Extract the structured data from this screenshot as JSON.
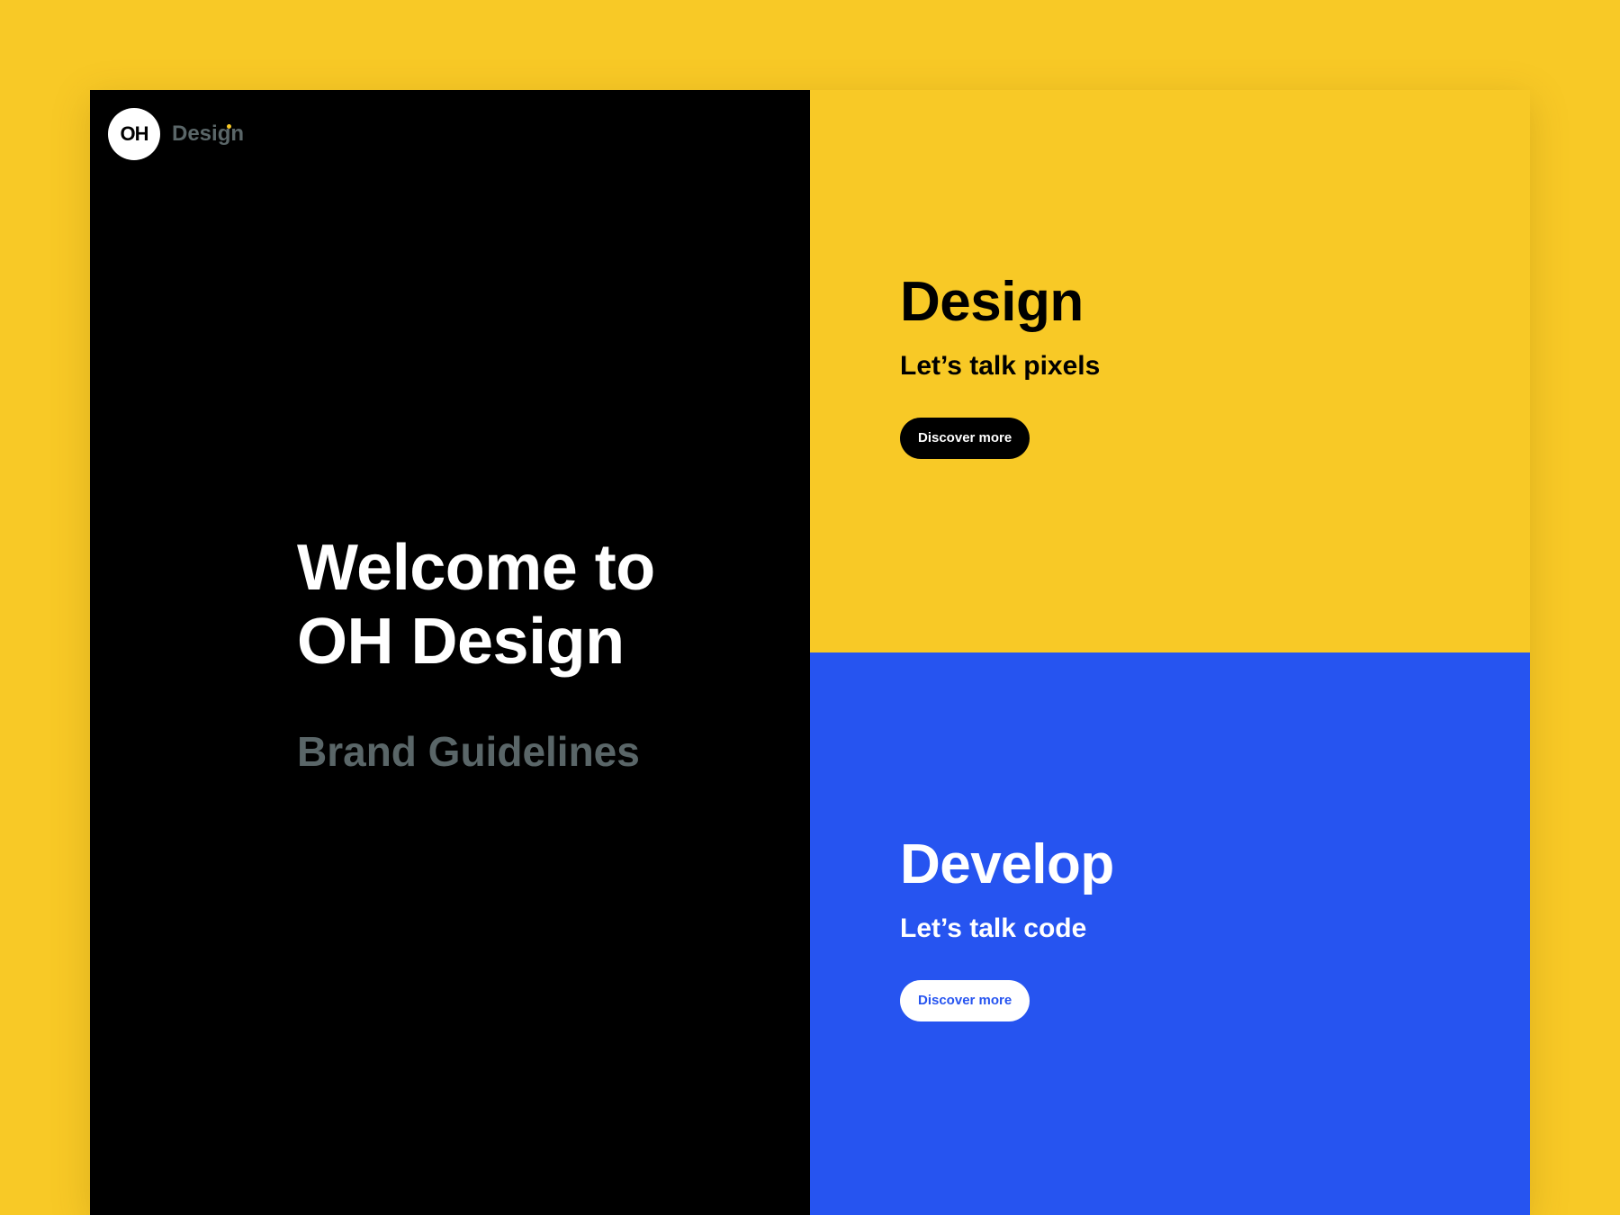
{
  "colors": {
    "background": "#F8C926",
    "left_panel": "#000000",
    "design_card": "#F8C926",
    "develop_card": "#2654F0",
    "muted_text": "#5A6668"
  },
  "logo": {
    "badge": "OH",
    "text": "Design"
  },
  "hero": {
    "title_line1": "Welcome to",
    "title_line2": "OH Design",
    "subtitle": "Brand Guidelines"
  },
  "cards": {
    "design": {
      "title": "Design",
      "subtitle": "Let’s talk pixels",
      "button": "Discover more"
    },
    "develop": {
      "title": "Develop",
      "subtitle": "Let’s talk code",
      "button": "Discover more"
    }
  }
}
